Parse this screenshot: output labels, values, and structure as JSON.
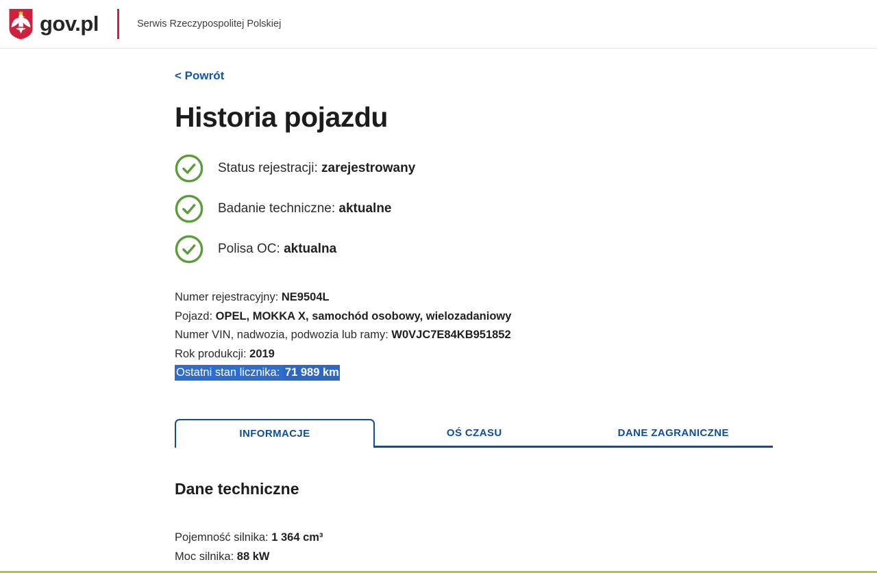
{
  "header": {
    "brand": "gov.pl",
    "tagline": "Serwis Rzeczypospolitej Polskiej",
    "emblem_icon": "polish-eagle-emblem"
  },
  "page": {
    "back_link": "< Powrót",
    "title": "Historia pojazdu"
  },
  "statuses": [
    {
      "icon": "check-circle-icon",
      "label": "Status rejestracji: ",
      "value": "zarejestrowany"
    },
    {
      "icon": "check-circle-icon",
      "label": "Badanie techniczne: ",
      "value": "aktualne"
    },
    {
      "icon": "check-circle-icon",
      "label": "Polisa OC: ",
      "value": "aktualna"
    }
  ],
  "vehicle_details": [
    {
      "label": "Numer rejestracyjny: ",
      "value": "NE9504L",
      "highlighted": false
    },
    {
      "label": "Pojazd: ",
      "value": "OPEL, MOKKA X, samochód osobowy, wielozadaniowy",
      "highlighted": false
    },
    {
      "label": "Numer VIN, nadwozia, podwozia lub ramy: ",
      "value": "W0VJC7E84KB951852",
      "highlighted": false
    },
    {
      "label": "Rok produkcji: ",
      "value": "2019",
      "highlighted": false
    },
    {
      "label": "Ostatni stan licznika: ",
      "value": "71 989 km",
      "highlighted": true
    }
  ],
  "tabs": [
    {
      "label": "INFORMACJE",
      "active": true
    },
    {
      "label": "OŚ CZASU",
      "active": false
    },
    {
      "label": "DANE ZAGRANICZNE",
      "active": false
    }
  ],
  "technical_section": {
    "title": "Dane techniczne",
    "fields": [
      {
        "label": "Pojemność silnika: ",
        "value": "1 364 cm³"
      },
      {
        "label": "Moc silnika: ",
        "value": "88 kW"
      }
    ]
  },
  "colors": {
    "link_blue": "#0e57a5",
    "tab_blue": "#0d4e9c",
    "check_green": "#5b9d39",
    "emblem_red": "#d0213c",
    "selection_blue": "#2e6cd0",
    "bottom_line_green": "#a5c469"
  }
}
